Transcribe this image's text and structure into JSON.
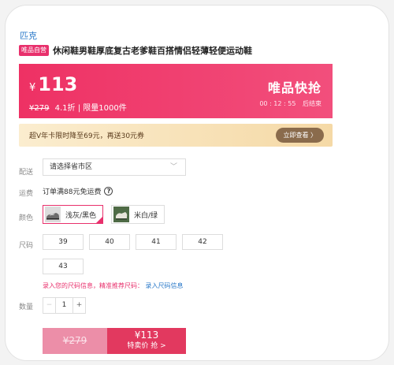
{
  "brand": "匹克",
  "badge": "唯品自营",
  "title": "休闲鞋男鞋厚底复古老爹鞋百搭情侣轻薄轻便运动鞋",
  "flash": {
    "currency": "¥",
    "price": "113",
    "original": "¥279",
    "discount": "4.1折",
    "separator": "|",
    "limit": "限量1000件",
    "logo": "唯品快抢",
    "countdown": "00 : 12 : 55",
    "countdown_suffix": "后结束"
  },
  "vip": {
    "text": "超V年卡限时降至69元，再送30元券",
    "button": "立即查看 〉"
  },
  "delivery": {
    "label": "配送",
    "placeholder": "请选择省市区",
    "chevron": "﹀"
  },
  "shipping": {
    "label": "运费",
    "text": "订单满88元免运费",
    "help": "?"
  },
  "color": {
    "label": "颜色",
    "options": [
      {
        "label": "浅灰/黑色",
        "selected": true
      },
      {
        "label": "米白/绿",
        "selected": false
      }
    ]
  },
  "size": {
    "label": "尺码",
    "options": [
      "39",
      "40",
      "41",
      "42",
      "43"
    ],
    "tip": "录入您的尺码信息，精准推荐尺码：",
    "tip_link": "录入尺码信息"
  },
  "quantity": {
    "label": "数量",
    "minus": "−",
    "value": "1",
    "plus": "+"
  },
  "buy": {
    "original": "¥279",
    "price": "¥113",
    "action": "特卖价 抢 >"
  },
  "colors": {
    "accent": "#e8306c",
    "link": "#2a79c9",
    "vip_button": "#8a6b4c"
  }
}
